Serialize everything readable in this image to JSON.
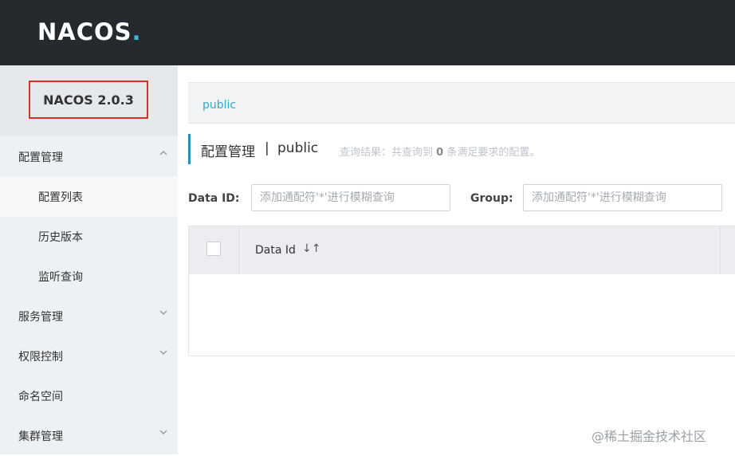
{
  "header": {
    "logo_main": "NACOS",
    "logo_dot": "."
  },
  "sidebar": {
    "version": "NACOS 2.0.3",
    "items": [
      {
        "label": "配置管理",
        "chevron": "chevron-up-icon"
      },
      {
        "label": "配置列表"
      },
      {
        "label": "历史版本"
      },
      {
        "label": "监听查询"
      },
      {
        "label": "服务管理",
        "chevron": "chevron-down-icon"
      },
      {
        "label": "权限控制",
        "chevron": "chevron-down-icon"
      },
      {
        "label": "命名空间"
      },
      {
        "label": "集群管理",
        "chevron": "chevron-down-icon"
      }
    ]
  },
  "breadcrumb": {
    "namespace": "public"
  },
  "page": {
    "title": "配置管理",
    "separator": "|",
    "namespace": "public",
    "summary_prefix": "查询结果：共查询到",
    "summary_count": "0",
    "summary_suffix": "条满足要求的配置。"
  },
  "filters": {
    "data_id_label": "Data ID:",
    "data_id_placeholder": "添加通配符'*'进行模糊查询",
    "group_label": "Group:",
    "group_placeholder": "添加通配符'*'进行模糊查询"
  },
  "table": {
    "columns": [
      "Data Id"
    ],
    "sort_icon": "↓↑"
  },
  "watermark": "@稀土掘金技术社区",
  "colors": {
    "topbar": "#252a2f",
    "accent": "#2fa9c5",
    "highlight_border": "#d9302c"
  }
}
